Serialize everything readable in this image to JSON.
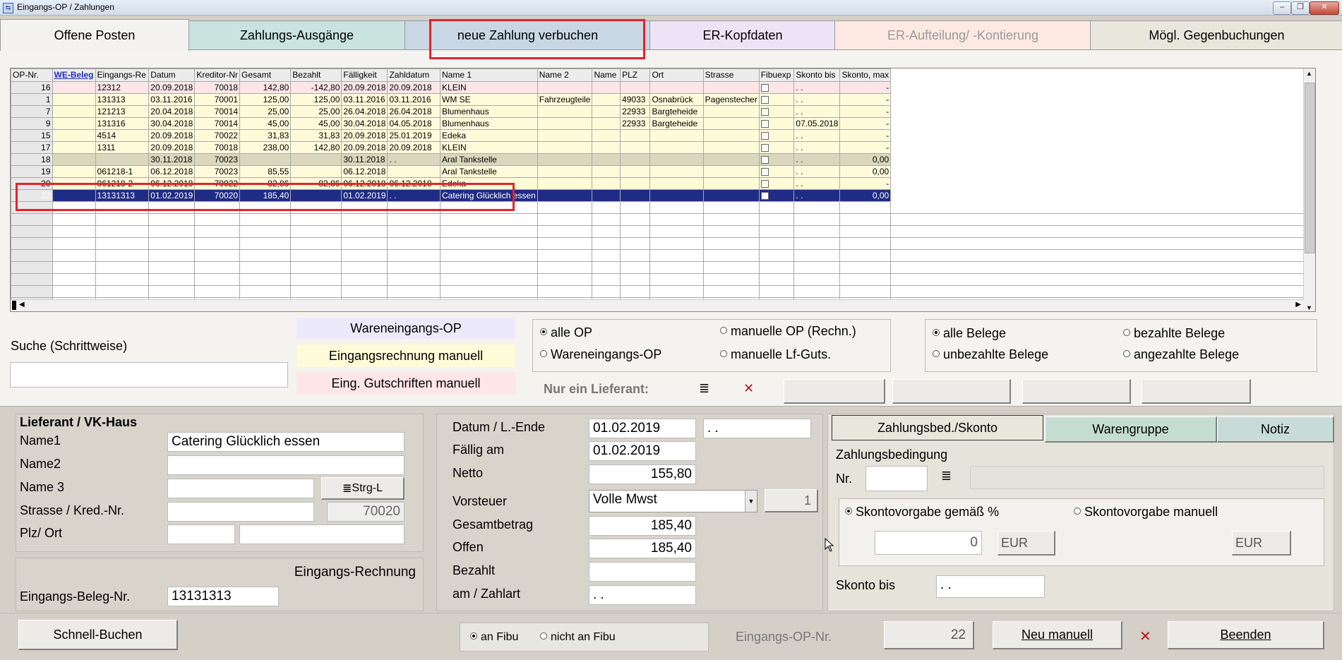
{
  "window": {
    "title": "Eingangs-OP / Zahlungen"
  },
  "tabs": [
    {
      "label": "Offene Posten",
      "bg": "#f3f2ee"
    },
    {
      "label": "Zahlungs-Ausgänge",
      "bg": "#c9e3df"
    },
    {
      "label": "neue Zahlung verbuchen",
      "bg": "#c9d7e5"
    },
    {
      "label": "ER-Kopfdaten",
      "bg": "#ece3f7"
    },
    {
      "label": "ER-Aufteilung/ -Kontierung",
      "bg": "#fde9e2"
    },
    {
      "label": "Mögl. Gegenbuchungen",
      "bg": "#e9e6dc"
    }
  ],
  "grid": {
    "columns": [
      "OP-Nr.",
      "WE-Beleg",
      "Eingangs-Re",
      "Datum",
      "Kreditor-Nr",
      "Gesamt",
      "Bezahlt",
      "Fälligkeit",
      "Zahldatum",
      "Name 1",
      "Name 2",
      "Name",
      "PLZ",
      "Ort",
      "Strasse",
      "Fibuexp",
      "Skonto bis",
      "Skonto, max"
    ],
    "rows": [
      {
        "style": "pink",
        "cells": [
          "16",
          "",
          "12312",
          "20.09.2018",
          "70018",
          "142,80",
          "-142,80",
          "20.09.2018",
          "20.09.2018",
          "KLEIN",
          "",
          "",
          "",
          "",
          "",
          "",
          ". .",
          "-"
        ]
      },
      {
        "style": "yellow",
        "cells": [
          "1",
          "",
          "131313",
          "03.11.2016",
          "70001",
          "125,00",
          "125,00",
          "03.11.2016",
          "03.11.2016",
          "WM SE",
          "Fahrzeugteile",
          "",
          "49033",
          "Osnabrück",
          "Pagenstecher",
          "",
          ". .",
          "-"
        ]
      },
      {
        "style": "yellow",
        "cells": [
          "7",
          "",
          "121213",
          "20.04.2018",
          "70014",
          "25,00",
          "25,00",
          "26.04.2018",
          "26.04.2018",
          "Blumenhaus",
          "",
          "",
          "22933",
          "Bargteheide",
          "",
          "",
          ". .",
          "-"
        ]
      },
      {
        "style": "yellow",
        "cells": [
          "9",
          "",
          "131316",
          "30.04.2018",
          "70014",
          "45,00",
          "45,00",
          "30.04.2018",
          "04.05.2018",
          "Blumenhaus",
          "",
          "",
          "22933",
          "Bargteheide",
          "",
          "",
          "07.05.2018",
          "-"
        ]
      },
      {
        "style": "yellow",
        "cells": [
          "15",
          "",
          "4514",
          "20.09.2018",
          "70022",
          "31,83",
          "31,83",
          "20.09.2018",
          "25.01.2019",
          "Edeka",
          "",
          "",
          "",
          "",
          "",
          "",
          ". .",
          "-"
        ]
      },
      {
        "style": "yellow",
        "cells": [
          "17",
          "",
          "1311",
          "20.09.2018",
          "70018",
          "238,00",
          "142,80",
          "20.09.2018",
          "20.09.2018",
          "KLEIN",
          "",
          "",
          "",
          "",
          "",
          "",
          ". .",
          "-"
        ]
      },
      {
        "style": "olive",
        "cells": [
          "18",
          "",
          "",
          "30.11.2018",
          "70023",
          "",
          "",
          "30.11.2018",
          ". .",
          "Aral Tankstelle",
          "",
          "",
          "",
          "",
          "",
          "",
          ". .",
          "0,00"
        ]
      },
      {
        "style": "yellow",
        "cells": [
          "19",
          "",
          "061218-1",
          "06.12.2018",
          "70023",
          "85,55",
          "",
          "06.12.2018",
          "",
          "Aral Tankstelle",
          "",
          "",
          "",
          "",
          "",
          "",
          ". .",
          "0,00"
        ]
      },
      {
        "style": "yellow",
        "cells": [
          "20",
          "",
          "061218-2",
          "06.12.2018",
          "70022",
          "82,86",
          "82,86",
          "06.12.2018",
          "06.12.2018",
          "Edeka",
          "",
          "",
          "",
          "",
          "",
          "",
          ". .",
          "-"
        ]
      },
      {
        "style": "sel",
        "cells": [
          "22",
          "",
          "13131313",
          "01.02.2019",
          "70020",
          "185,40",
          "",
          "01.02.2019",
          ". .",
          "Catering Glücklich essen",
          "",
          "",
          "",
          "",
          "",
          "",
          ". .",
          "0,00"
        ]
      }
    ],
    "empty_rows": 10
  },
  "filter_legend": {
    "we_op": "Wareneingangs-OP",
    "er_manuell": "Eingangsrechnung manuell",
    "gutschriften": "Eing. Gutschriften manuell",
    "we_color": "#eceafa",
    "er_color": "#fefbd9",
    "gs_color": "#fde5e8"
  },
  "search": {
    "label": "Suche (Schrittweise)",
    "value": ""
  },
  "op_radios": {
    "alle_op": "alle OP",
    "we_op": "Wareneingangs-OP",
    "manuelle_op": "manuelle OP (Rechn.)",
    "manuelle_gs": "manuelle Lf-Guts."
  },
  "beleg_radios": {
    "alle": "alle Belege",
    "unbezahlt": "unbezahlte Belege",
    "bezahlt": "bezahlte Belege",
    "angezahlt": "angezahlte Belege"
  },
  "lieferant_filter": {
    "label": "Nur ein Lieferant:",
    "list_icon": "≣",
    "clear_icon": "✕"
  },
  "lieferant": {
    "header": "Lieferant / VK-Haus",
    "name1_label": "Name1",
    "name1": "Catering Glücklich essen",
    "name2_label": "Name2",
    "name2": "",
    "name3_label": "Name 3",
    "name3": "",
    "strg_button": "Strg-L",
    "strasse_label": "Strasse / Kred.-Nr.",
    "strasse": "",
    "kred_nr": "70020",
    "plz_label": "Plz/ Ort",
    "plz": "",
    "ort": ""
  },
  "rechnung": {
    "header": "Eingangs-Rechnung",
    "beleg_label": "Eingangs-Beleg-Nr.",
    "beleg_nr": "13131313"
  },
  "betraege": {
    "datum_label": "Datum / L.-Ende",
    "datum": "01.02.2019",
    "l_ende": ". .",
    "faellig_label": "Fällig am",
    "faellig": "01.02.2019",
    "netto_label": "Netto",
    "netto": "155,80",
    "vorsteuer_label": "Vorsteuer",
    "vorsteuer": "Volle Mwst",
    "vorsteuer_code": "1",
    "gesamt_label": "Gesamtbetrag",
    "gesamt": "185,40",
    "offen_label": "Offen",
    "offen": "185,40",
    "bezahlt_label": "Bezahlt",
    "bezahlt": "",
    "zahlart_label": "am / Zahlart",
    "zahlart": ". ."
  },
  "subtabs": [
    {
      "label": "Zahlungsbed./Skonto",
      "bg": "#e9e6dc"
    },
    {
      "label": "Warengruppe",
      "bg": "#c5ddd0"
    },
    {
      "label": "Notiz",
      "bg": "#c7dcd8"
    }
  ],
  "zahlungsbed": {
    "header": "Zahlungsbedingung",
    "nr_label": "Nr.",
    "nr": "",
    "desc": "",
    "skonto_prozent": "Skontovorgabe gemäß %",
    "skonto_manuell": "Skontovorgabe manuell",
    "skonto_value": "0",
    "eur1": "EUR",
    "eur2": "EUR",
    "skonto_bis_label": "Skonto bis",
    "skonto_bis": ". ."
  },
  "footer": {
    "schnell_buchen": "Schnell-Buchen",
    "an_fibu": "an Fibu",
    "nicht_an_fibu": "nicht an Fibu",
    "op_nr_label": "Eingangs-OP-Nr.",
    "op_nr": "22",
    "neu_manuell": "Neu manuell",
    "clear_icon": "✕",
    "beenden": "Beenden"
  }
}
